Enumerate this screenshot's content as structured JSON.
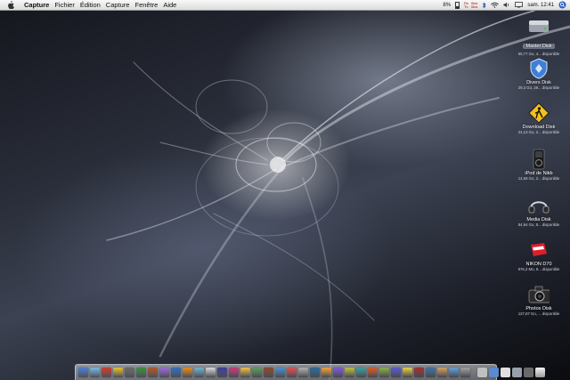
{
  "menubar": {
    "app_name": "Capture",
    "menus": [
      "Fichier",
      "Édition",
      "Capture",
      "Fenêtre",
      "Aide"
    ],
    "battery_text": "8%",
    "net_label_1": "Rx",
    "net_label_2": "Tx",
    "net_rate_1": "0k/s",
    "net_rate_2": "0k/s",
    "clock": "sam. 12:41"
  },
  "drives": [
    {
      "name": "Master Disk",
      "free": "55,77 Go, 4... disponible",
      "icon": "hard-drive-icon"
    },
    {
      "name": "Divers Disk",
      "free": "29,3 Go, 26... disponible",
      "icon": "shield-drive-icon"
    },
    {
      "name": "Download Disk",
      "free": "24,13 Go, 2... disponible",
      "icon": "pedestrian-sign-icon"
    },
    {
      "name": "iPod de Nikb",
      "free": "14,59 Go, 2... disponible",
      "icon": "ipod-icon"
    },
    {
      "name": "Media Disk",
      "free": "84,94 Go, 5... disponible",
      "icon": "headphones-icon"
    },
    {
      "name": "NIKON D70",
      "free": "976,2 Mo, 9... disponible",
      "icon": "memory-card-icon"
    },
    {
      "name": "Photos Disk",
      "free": "127,87 Go, ... disponible",
      "icon": "camera-icon"
    }
  ],
  "dock": {
    "app_colors": [
      "#4a7fd6",
      "#7ab8e8",
      "#d23a2e",
      "#e6c229",
      "#6b6b6b",
      "#3a8f3a",
      "#b4542a",
      "#9c6ad6",
      "#2e6fbf",
      "#e88c1a",
      "#6fb3d2",
      "#d9d9d9",
      "#3d3d9e",
      "#c73a7a",
      "#f0c040",
      "#5c9c5c",
      "#8a4a2a",
      "#4a90d0",
      "#e05050",
      "#b0b0b0",
      "#2a6a9a",
      "#f2a33a",
      "#7b5bd6",
      "#c0c040",
      "#3aa0a0",
      "#d65c2a",
      "#8ab04a",
      "#5a5ad0",
      "#e8d040",
      "#a03030",
      "#4070a0",
      "#d0a060",
      "#60a0e0",
      "#a0a0a0"
    ],
    "doc_colors": [
      "#c0c0c0",
      "#5a8ad0",
      "#e0e0e0",
      "#9aa0aa",
      "#6a6a6a"
    ],
    "trash_icon": "trash-icon"
  }
}
